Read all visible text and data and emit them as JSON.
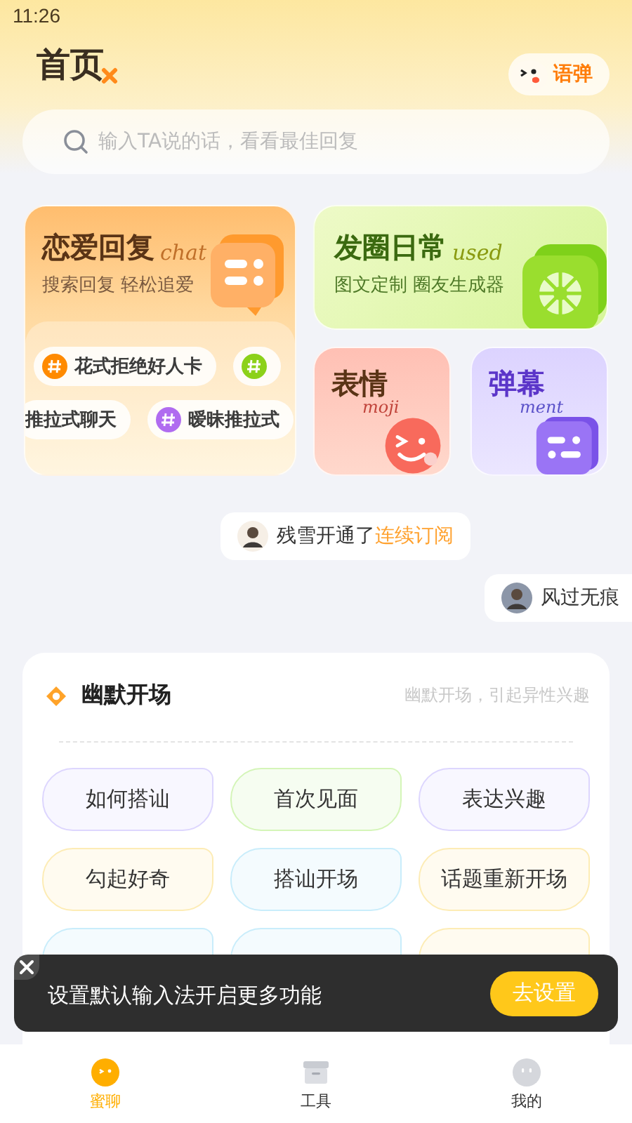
{
  "status_bar": {
    "time": "11:26"
  },
  "header": {
    "title": "首页",
    "badge_label": "语弹"
  },
  "search": {
    "placeholder": "输入TA说的话，看看最佳回复"
  },
  "cards": [
    {
      "kind": "main",
      "title": "恋爱回复",
      "deco": "chat",
      "subtitle": "搜索回复 轻松追爱",
      "tags": [
        {
          "label": "花式拒绝好人卡",
          "color": "#ff8a00"
        },
        {
          "color": "#8cd11a"
        },
        {
          "label": "推拉式聊天"
        },
        {
          "label": "暧昧推拉式",
          "color": "#b06cf0"
        }
      ]
    },
    {
      "kind": "wide",
      "title": "发圈日常",
      "deco": "used",
      "subtitle": "图文定制 圈友生成器"
    },
    {
      "kind": "emoji",
      "title": "表情",
      "deco": "moji"
    },
    {
      "kind": "danmaku",
      "title": "弹幕",
      "deco": "ment"
    }
  ],
  "ticker": [
    {
      "text": "残雪开通了",
      "highlight": "连续订阅"
    },
    {
      "text": "风过无痕"
    }
  ],
  "section": {
    "title": "幽默开场",
    "subtitle": "幽默开场，引起异性兴趣",
    "chips": [
      {
        "label": "如何搭讪",
        "color": "#ddd6fe"
      },
      {
        "label": "首次见面",
        "color": "#d4f5b8"
      },
      {
        "label": "表达兴趣",
        "color": "#ddd6fe"
      },
      {
        "label": "勾起好奇",
        "color": "#fdecb5"
      },
      {
        "label": "搭讪开场",
        "color": "#c9edfb"
      },
      {
        "label": "话题重新开场",
        "color": "#fdecb5"
      },
      {
        "color": "#c9edfb"
      },
      {
        "color": "#c9edfb"
      },
      {
        "color": "#fdecb5"
      }
    ]
  },
  "toast": {
    "message": "设置默认输入法开启更多功能",
    "action": "去设置"
  },
  "tabs": [
    {
      "label": "蜜聊",
      "selected": true
    },
    {
      "label": "工具",
      "selected": false
    },
    {
      "label": "我的",
      "selected": false
    }
  ]
}
